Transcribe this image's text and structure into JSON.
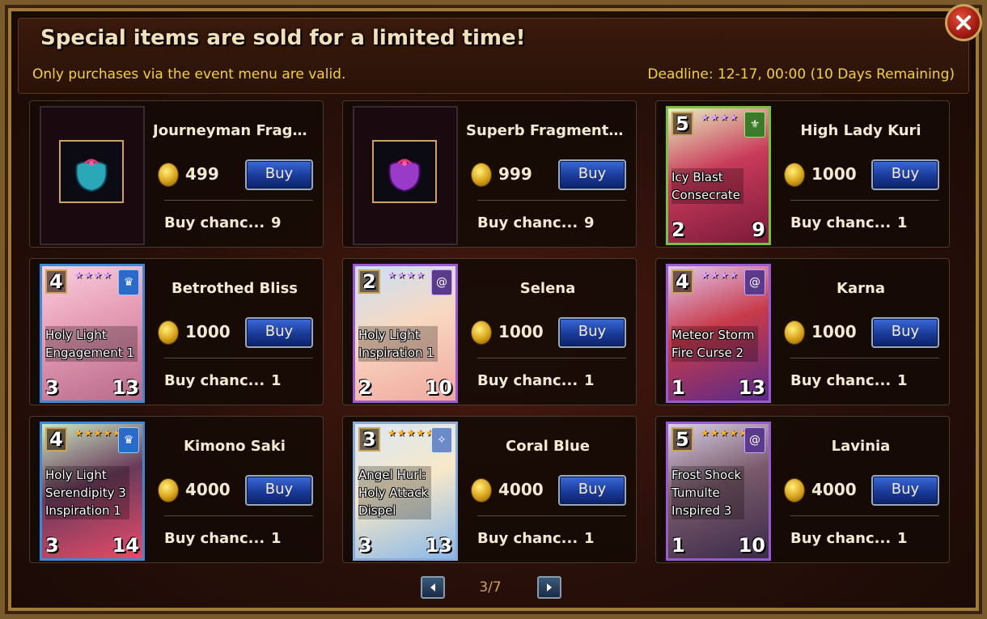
{
  "header": {
    "title": "Special items are sold for a limited time!",
    "subtitle": "Only purchases via the event menu are valid.",
    "deadline": "Deadline: 12-17, 00:00 (10 Days Remaining)"
  },
  "items": [
    {
      "name": "Journeyman Fragm...",
      "price": "499",
      "buy_label": "Buy",
      "chance_label": "Buy chanc...",
      "chance_value": "9",
      "kind": "item",
      "icon": "teal-pouch-icon"
    },
    {
      "name": "Superb Fragments ...",
      "price": "999",
      "buy_label": "Buy",
      "chance_label": "Buy chanc...",
      "chance_value": "9",
      "kind": "item",
      "icon": "purple-pouch-icon"
    },
    {
      "name": "High Lady Kuri",
      "price": "1000",
      "buy_label": "Buy",
      "chance_label": "Buy chanc...",
      "chance_value": "1",
      "kind": "card",
      "card": {
        "cost": "5",
        "stars": "★★★★",
        "skills": [
          "Icy Blast",
          "Consecrate"
        ],
        "left_stat": "2",
        "right_stat": "9"
      }
    },
    {
      "name": "Betrothed Bliss",
      "price": "1000",
      "buy_label": "Buy",
      "chance_label": "Buy chanc...",
      "chance_value": "1",
      "kind": "card",
      "card": {
        "cost": "4",
        "stars": "★★★★",
        "skills": [
          "Holy Light",
          "Engagement 1"
        ],
        "left_stat": "3",
        "right_stat": "13"
      }
    },
    {
      "name": "Selena",
      "price": "1000",
      "buy_label": "Buy",
      "chance_label": "Buy chanc...",
      "chance_value": "1",
      "kind": "card",
      "card": {
        "cost": "2",
        "stars": "★★★★",
        "skills": [
          "Holy Light",
          "Inspiration 1"
        ],
        "left_stat": "2",
        "right_stat": "10"
      }
    },
    {
      "name": "Karna",
      "price": "1000",
      "buy_label": "Buy",
      "chance_label": "Buy chanc...",
      "chance_value": "1",
      "kind": "card",
      "card": {
        "cost": "4",
        "stars": "★★★★",
        "skills": [
          "Meteor Storm",
          "Fire Curse 2"
        ],
        "left_stat": "1",
        "right_stat": "13"
      }
    },
    {
      "name": "Kimono Saki",
      "price": "4000",
      "buy_label": "Buy",
      "chance_label": "Buy chanc...",
      "chance_value": "1",
      "kind": "card",
      "card": {
        "cost": "4",
        "stars": "★★★★★",
        "skills": [
          "Holy Light",
          "Serendipity 3",
          "Inspiration 1"
        ],
        "left_stat": "3",
        "right_stat": "14"
      }
    },
    {
      "name": "Coral Blue",
      "price": "4000",
      "buy_label": "Buy",
      "chance_label": "Buy chanc...",
      "chance_value": "1",
      "kind": "card",
      "card": {
        "cost": "3",
        "stars": "★★★★★",
        "skills": [
          "Angel Hurl:",
          "Holy Attack",
          "Dispel"
        ],
        "left_stat": "3",
        "right_stat": "13"
      }
    },
    {
      "name": "Lavinia",
      "price": "4000",
      "buy_label": "Buy",
      "chance_label": "Buy chanc...",
      "chance_value": "1",
      "kind": "card",
      "card": {
        "cost": "5",
        "stars": "★★★★★",
        "skills": [
          "Frost Shock",
          "Tumulte",
          "Inspired 3"
        ],
        "left_stat": "1",
        "right_stat": "10"
      }
    }
  ],
  "pager": {
    "current": "3/7"
  },
  "colors": {
    "title": "#f1e0b8",
    "accent_yellow": "#f2d23a",
    "buy_button": "#1a3a98",
    "coin": "#d8a018"
  }
}
